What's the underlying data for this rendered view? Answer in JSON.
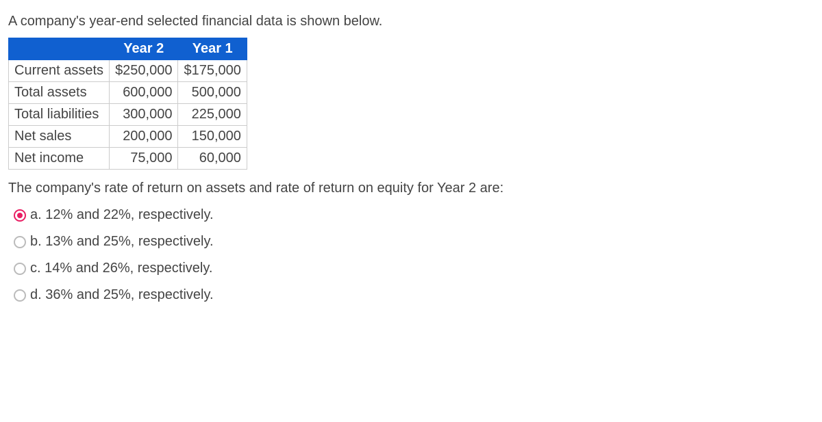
{
  "intro": "A company's year-end selected financial data is shown below.",
  "table": {
    "headers": [
      "",
      "Year 2",
      "Year 1"
    ],
    "rows": [
      {
        "label": "Current assets",
        "y2": "$250,000",
        "y1": "$175,000"
      },
      {
        "label": "Total assets",
        "y2": "600,000",
        "y1": "500,000"
      },
      {
        "label": "Total liabilities",
        "y2": "300,000",
        "y1": "225,000"
      },
      {
        "label": "Net sales",
        "y2": "200,000",
        "y1": "150,000"
      },
      {
        "label": "Net income",
        "y2": "75,000",
        "y1": "60,000"
      }
    ]
  },
  "prompt": "The company's rate of return on assets and rate of return on equity for Year 2 are:",
  "options": [
    {
      "key": "a",
      "label": "a. 12% and 22%, respectively.",
      "selected": true
    },
    {
      "key": "b",
      "label": "b. 13% and 25%, respectively.",
      "selected": false
    },
    {
      "key": "c",
      "label": "c. 14% and 26%, respectively.",
      "selected": false
    },
    {
      "key": "d",
      "label": "d. 36% and 25%, respectively.",
      "selected": false
    }
  ]
}
